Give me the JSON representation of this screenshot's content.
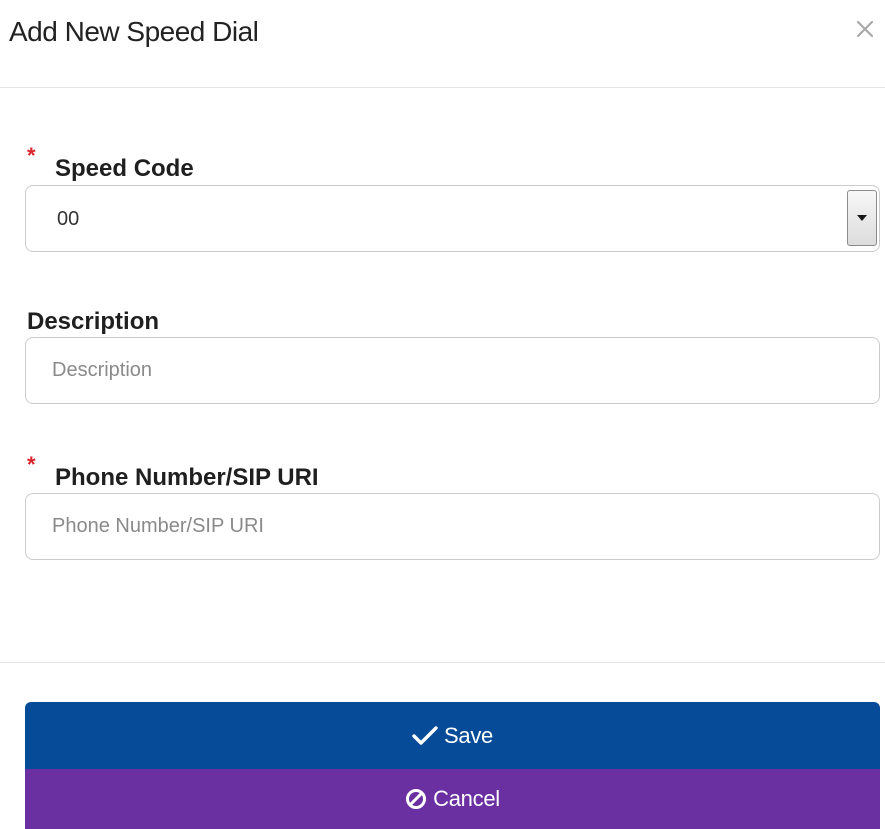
{
  "dialog": {
    "title": "Add New Speed Dial",
    "close_icon": "close-icon"
  },
  "form": {
    "speed_code": {
      "label": "Speed Code",
      "required_mark": "*",
      "value": "00",
      "arrow_icon": "chevron-down-icon"
    },
    "description": {
      "label": "Description",
      "value": "",
      "placeholder": "Description"
    },
    "phone": {
      "label": "Phone Number/SIP URI",
      "required_mark": "*",
      "value": "",
      "placeholder": "Phone Number/SIP URI"
    }
  },
  "actions": {
    "save_label": "Save",
    "save_icon": "checkmark-icon",
    "cancel_label": "Cancel",
    "cancel_icon": "ban-icon"
  },
  "colors": {
    "save_bg": "#054b97",
    "cancel_bg": "#6a2fa0",
    "required": "#d9262c"
  }
}
